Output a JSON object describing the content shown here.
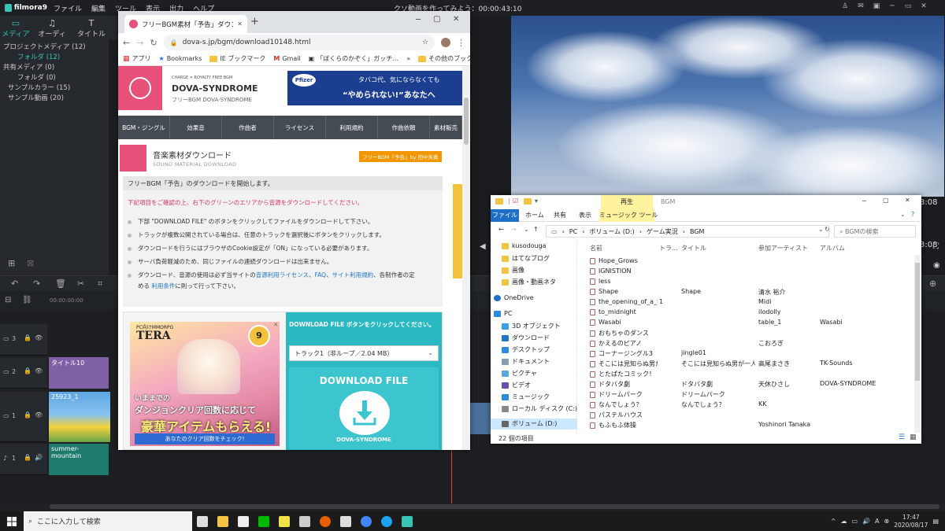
{
  "filmora": {
    "logo": "filmora9",
    "menus": [
      "ファイル",
      "編集",
      "ツール",
      "表示",
      "出力",
      "ヘルプ"
    ],
    "title": "クソ動画を作ってみよう：00:00:43:10",
    "tabs": [
      {
        "icon": "▭",
        "label": "メディア"
      },
      {
        "icon": "♫",
        "label": "オーディオ"
      },
      {
        "icon": "T",
        "label": "タイトル"
      }
    ],
    "library": [
      "プロジェクトメディア (12)",
      "フォルダ (12)",
      "共有メディア (0)",
      "フォルダ (0)",
      "サンプルカラー (15)",
      "サンプル動画 (20)"
    ],
    "timecode": "3:08",
    "ruler_start": "00:00:00:00",
    "tracks": [
      {
        "num": "3",
        "icon": "▭"
      },
      {
        "num": "2",
        "icon": "▭"
      },
      {
        "num": "1",
        "icon": "▭"
      },
      {
        "num": "1",
        "icon": "♪"
      }
    ],
    "clips": {
      "title": "タイトル10",
      "video": "25923_1",
      "audio": "summer-mountain"
    }
  },
  "chrome": {
    "tab_title": "フリーBGM素材「予告」ダウンロード",
    "url": "dova-s.jp/bgm/download10148.html",
    "bookmarks": [
      "アプリ",
      "Bookmarks",
      "IE ブックマーク",
      "Gmail",
      "「ぼくらのかぞく」ガッチ…",
      "その他のブックマーク"
    ],
    "header": {
      "small": "CHARGE × ROYALTY FREE BGM",
      "name": "DOVA-SYNDROME",
      "tagline": "フリーBGM DOVA-SYNDROME"
    },
    "ad": {
      "logo": "Pfizer",
      "line1": "タバコ代、気にならなくても",
      "line2": "“やめられない!”あなたへ"
    },
    "nav": [
      "BGM・ジングル",
      "効果音",
      "作曲者",
      "ライセンス",
      "利用規約",
      "作曲依頼",
      "素材販売"
    ],
    "section": {
      "title": "音楽素材ダウンロード",
      "sub": "SOUND MATERIAL DOWNLOAD",
      "badge": "フリーBGM「予告」by 田中芳典"
    },
    "info_head": "フリーBGM「予告」のダウンロードを開始します。",
    "warning": "下記項目をご確認の上、右下のグリーンのエリアから音源をダウンロードしてください。",
    "bullets": [
      "下部 \"DOWNLOAD FILE\" のボタンをクリックしてファイルをダウンロードして下さい。",
      "トラックが複数公開されている場合は、任意のトラックを選択後にボタンをクリックします。",
      "ダウンロードを行うにはブラウザのCookie設定が「ON」になっている必要があります。",
      "サーバ負荷軽減のため、同じファイルの連続ダウンロードは出来ません。"
    ],
    "b5": {
      "a": "ダウンロード、音源の使用は必ず当サイトの",
      "l1": "音源利用ライセンス",
      "s1": "、",
      "l2": "FAQ",
      "s2": "、",
      "l3": "サイト利用規約",
      "b": "、各制作者の定",
      "c": "める",
      "l4": "利用条件",
      "d": "に則って行って下さい。"
    },
    "tera": {
      "pc": "PC向けMMORPG",
      "logo": "TERA",
      "badge": "9",
      "l1": "いままでの",
      "l2": "ダンジョンクリア回数に応じて",
      "l3": "豪華アイテムもらえる!",
      "l4": "あなたのクリア回数をチェック!"
    },
    "dl_note": "DOWNLOAD FILE ボタンをクリックしてください。",
    "dl_select": "トラック1（非ループ／2.04 MB）",
    "dl_button": "DOWNLOAD FILE",
    "dl_brand": "DOVA-SYNDROME"
  },
  "explorer": {
    "play_tab": "再生",
    "title": "BGM",
    "ribbon": [
      "ファイル",
      "ホーム",
      "共有",
      "表示",
      "ミュージック ツール"
    ],
    "path": [
      "PC",
      "ボリューム (D:)",
      "ゲーム実況",
      "BGM"
    ],
    "search": "BGMの検索",
    "nav": [
      {
        "label": "kusodouga",
        "icon": "folder"
      },
      {
        "label": "はてなブログ",
        "icon": "folder"
      },
      {
        "label": "画像",
        "icon": "folder"
      },
      {
        "label": "画像・動画ネタ",
        "icon": "folder"
      },
      {
        "label": "OneDrive",
        "icon": "cloud"
      },
      {
        "label": "PC",
        "icon": "pc"
      },
      {
        "label": "3D オブジェクト",
        "icon": "3d"
      },
      {
        "label": "ダウンロード",
        "icon": "download"
      },
      {
        "label": "デスクトップ",
        "icon": "desktop"
      },
      {
        "label": "ドキュメント",
        "icon": "doc"
      },
      {
        "label": "ピクチャ",
        "icon": "pic"
      },
      {
        "label": "ビデオ",
        "icon": "video"
      },
      {
        "label": "ミュージック",
        "icon": "music"
      },
      {
        "label": "ローカル ディスク (C:)",
        "icon": "disk"
      },
      {
        "label": "ボリューム (D:)",
        "icon": "disk"
      }
    ],
    "columns": [
      "名前",
      "トラ...",
      "タイトル",
      "参加アーティスト",
      "アルバム"
    ],
    "files": [
      {
        "name": "Hope_Grows",
        "track": "",
        "title": "",
        "artist": "",
        "album": ""
      },
      {
        "name": "IGNISTION",
        "track": "",
        "title": "",
        "artist": "",
        "album": ""
      },
      {
        "name": "less",
        "track": "",
        "title": "",
        "artist": "",
        "album": ""
      },
      {
        "name": "Shape",
        "track": "",
        "title": "Shape",
        "artist": "清水 裕介",
        "album": ""
      },
      {
        "name": "the_opening_of_a_b...",
        "track": "1",
        "title": "",
        "artist": "Midi",
        "album": ""
      },
      {
        "name": "to_midnight",
        "track": "",
        "title": "",
        "artist": "ilodolly",
        "album": ""
      },
      {
        "name": "Wasabi",
        "track": "",
        "title": "",
        "artist": "table_1",
        "album": "Wasabi"
      },
      {
        "name": "おもちゃのダンス",
        "track": "",
        "title": "",
        "artist": "",
        "album": ""
      },
      {
        "name": "かえるのピアノ",
        "track": "",
        "title": "",
        "artist": "こおろぎ",
        "album": ""
      },
      {
        "name": "コーナージングル3",
        "track": "",
        "title": "jingle01",
        "artist": "",
        "album": ""
      },
      {
        "name": "そこには見知らぬ男が…",
        "track": "",
        "title": "そこには見知らぬ男が一人……",
        "artist": "高尾まさき",
        "album": "TK-Sounds"
      },
      {
        "name": "とたぱたコミック！",
        "track": "",
        "title": "",
        "artist": "",
        "album": ""
      },
      {
        "name": "ドタバタ劇",
        "track": "",
        "title": "ドタバタ劇",
        "artist": "天休ひさし",
        "album": "DOVA-SYNDROME"
      },
      {
        "name": "ドリームパーク",
        "track": "",
        "title": "ドリームパーク",
        "artist": "",
        "album": ""
      },
      {
        "name": "なんでしょう？",
        "track": "",
        "title": "なんでしょう？",
        "artist": "KK",
        "album": ""
      },
      {
        "name": "パステルハウス",
        "track": "",
        "title": "",
        "artist": "",
        "album": ""
      },
      {
        "name": "もふもふ体操",
        "track": "",
        "title": "",
        "artist": "Yoshinori Tanaka",
        "album": ""
      }
    ],
    "status": "22 個の項目"
  },
  "taskbar": {
    "search": "ここに入力して検索",
    "time": "17:47",
    "date": "2020/08/17",
    "apps": [
      {
        "icon": "task-view-icon",
        "color": "#dddddd"
      },
      {
        "icon": "explorer-icon",
        "color": "#f5c443"
      },
      {
        "icon": "store-icon",
        "color": "#eeeeee"
      },
      {
        "icon": "line-icon",
        "color": "#00b900"
      },
      {
        "icon": "sticky-icon",
        "color": "#f3e34b"
      },
      {
        "icon": "photos-icon",
        "color": "#cccccc"
      },
      {
        "icon": "firefox-icon",
        "color": "#e66000"
      },
      {
        "icon": "settings-icon",
        "color": "#dddddd"
      },
      {
        "icon": "chrome-icon",
        "color": "#4285f4"
      },
      {
        "icon": "twitter-icon",
        "color": "#1da1f2"
      },
      {
        "icon": "filmora-icon",
        "color": "#39c4b6"
      }
    ]
  }
}
